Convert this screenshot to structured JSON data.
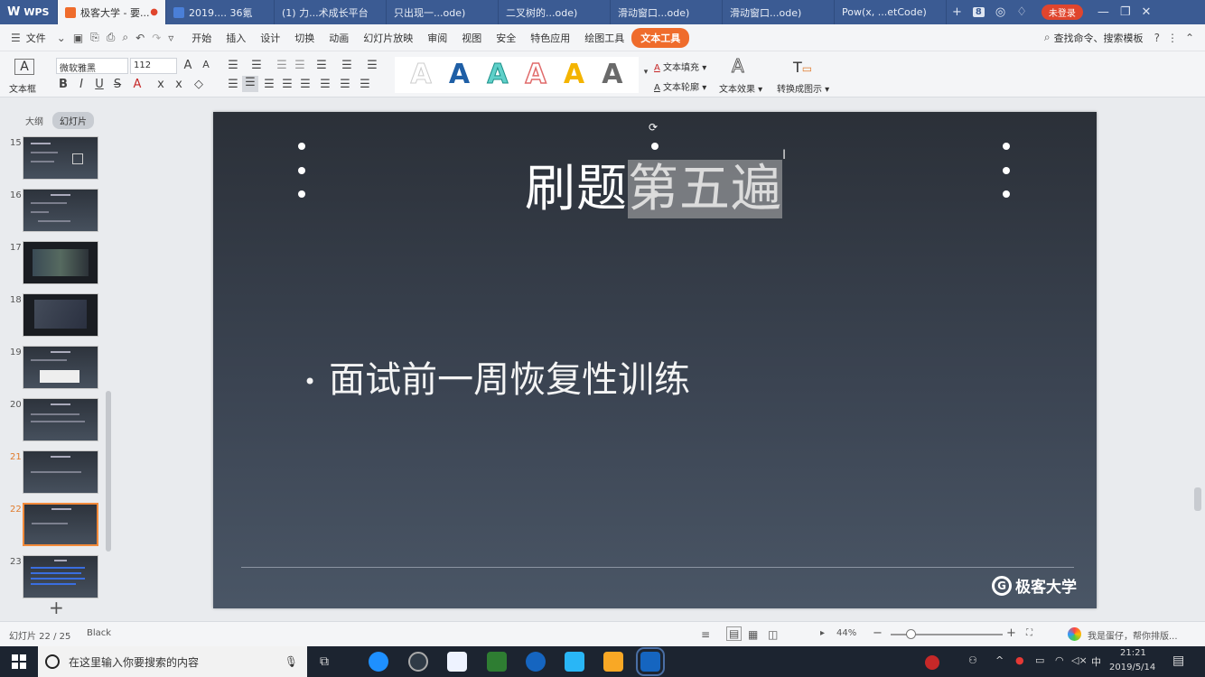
{
  "tabs": [
    {
      "label": "WPS"
    },
    {
      "label": "极客大学 - 要...",
      "active": true
    },
    {
      "label": "2019.... 36氪"
    },
    {
      "label": "(1) 力...术成长平台"
    },
    {
      "label": "只出现一...ode)"
    },
    {
      "label": "二叉树的...ode)"
    },
    {
      "label": "滑动窗口...ode)"
    },
    {
      "label": "滑动窗口...ode)"
    },
    {
      "label": "Pow(x, ...etCode)"
    }
  ],
  "tab_count_badge": "8",
  "login_button": "未登录",
  "menu": {
    "file": "文件",
    "items": [
      "开始",
      "插入",
      "设计",
      "切换",
      "动画",
      "幻灯片放映",
      "审阅",
      "视图",
      "安全",
      "特色应用",
      "绘图工具"
    ],
    "active": "文本工具",
    "search_label": "查找命令、搜索模板"
  },
  "ribbon": {
    "textbox_label": "文本框",
    "font_name": "微软雅黑",
    "font_size": "112",
    "text_fill": "文本填充",
    "text_outline": "文本轮廓",
    "text_effect": "文本效果",
    "convert_to_graphic": "转换成图示"
  },
  "left_panel": {
    "tab_outline": "大纲",
    "tab_slides": "幻灯片",
    "slide_numbers": [
      "15",
      "16",
      "17",
      "18",
      "19",
      "20",
      "21",
      "22",
      "23"
    ],
    "selected_slide": "22",
    "add_label": "+"
  },
  "slide": {
    "title_normal": "刷题",
    "title_selected": "第五遍",
    "bullet_dot": "•",
    "bullet": "面试前一周恢复性训练",
    "logo_text": "极客大学"
  },
  "status": {
    "slide_counter": "幻灯片 22 / 25",
    "theme": "Black",
    "zoom": "44%",
    "assistant": "我是蛋仔，帮你排版..."
  },
  "taskbar": {
    "search_placeholder": "在这里输入你要搜索的内容",
    "time": "21:21",
    "date": "2019/5/14",
    "ime": "中"
  },
  "colors": {
    "tab_bar": "#3b5b93",
    "accent_orange": "#ef6c2c",
    "slide_dark": "#2b3038",
    "taskbar": "#1c2430"
  }
}
